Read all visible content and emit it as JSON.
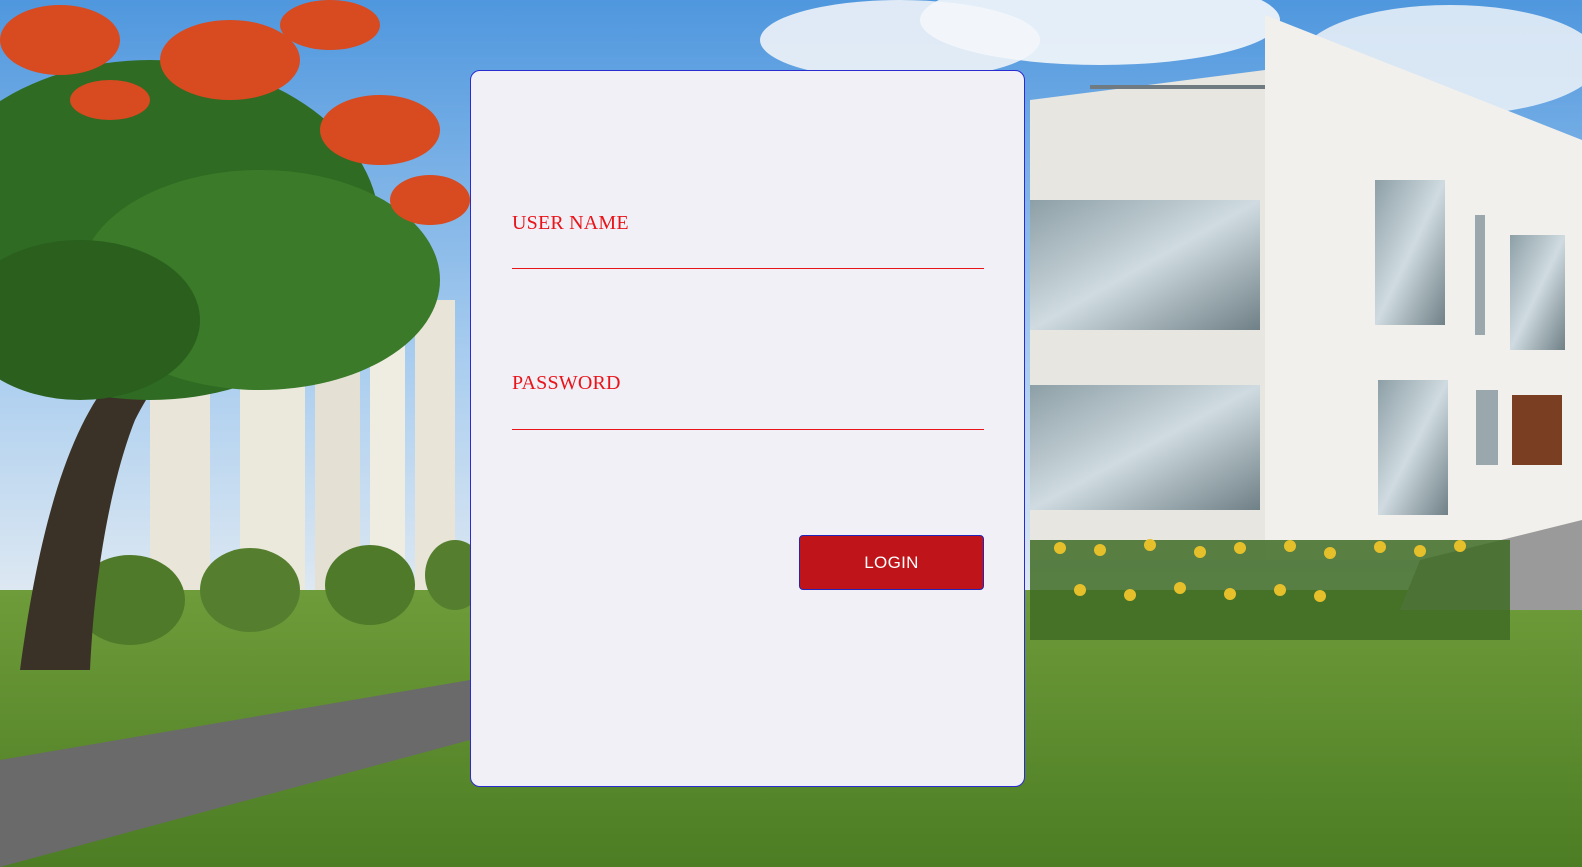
{
  "login_form": {
    "username_label": "USER NAME",
    "username_value": "",
    "username_placeholder": "",
    "password_label": "PASSWORD",
    "password_value": "",
    "password_placeholder": "",
    "login_button_label": "LOGIN"
  },
  "colors": {
    "label_color": "#e8141a",
    "button_color": "#bf1419",
    "card_background": "#f1f0f6",
    "card_border": "#2b2bd0"
  }
}
